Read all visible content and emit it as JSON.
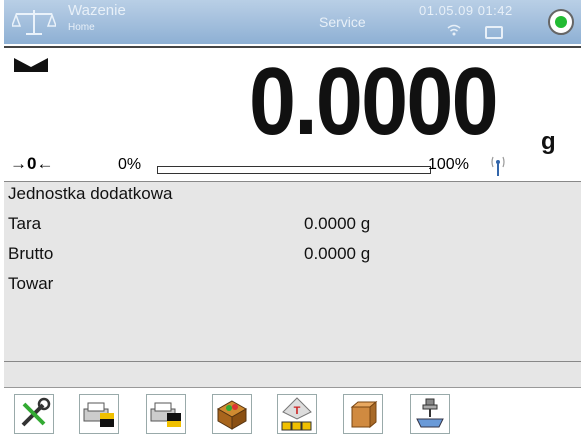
{
  "header": {
    "title": "Wazenie",
    "subtitle": "Home",
    "mode": "Service",
    "datetime": "01.05.09 01:42"
  },
  "weighing": {
    "reading": "0.0000",
    "unit": "g",
    "zero_indicator": "→0←",
    "range_min": "0%",
    "range_max": "100%",
    "load_fraction": 0
  },
  "info": {
    "rows": [
      {
        "label": "Jednostka dodatkowa",
        "value": ""
      },
      {
        "label": "Tara",
        "value": "0.0000 g"
      },
      {
        "label": "Brutto",
        "value": "0.0000 g"
      },
      {
        "label": "Towar",
        "value": ""
      }
    ]
  },
  "toolbar": {
    "buttons": [
      {
        "icon": "tools-icon"
      },
      {
        "icon": "printer-header-icon"
      },
      {
        "icon": "printer-footer-icon"
      },
      {
        "icon": "product-database-icon"
      },
      {
        "icon": "tare-icon"
      },
      {
        "icon": "packaging-box-icon"
      },
      {
        "icon": "weighing-pan-icon"
      }
    ]
  },
  "colors": {
    "header_top": "#b9cfe6",
    "header_bottom": "#8eb0d4",
    "status_ok": "#22bb33",
    "panel_bg": "#e6e6e6"
  }
}
